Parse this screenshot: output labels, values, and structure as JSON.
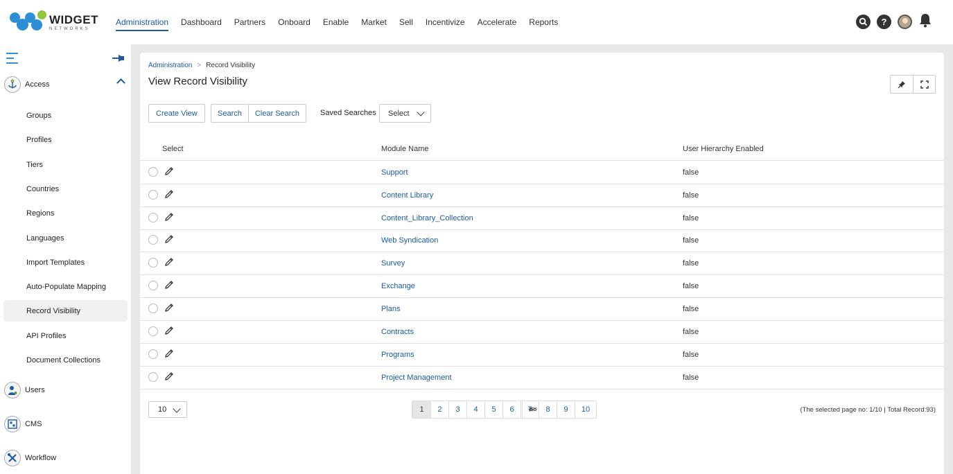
{
  "brand": {
    "title": "WIDGET",
    "subtitle": "NETWORKS"
  },
  "nav": {
    "items": [
      "Administration",
      "Dashboard",
      "Partners",
      "Onboard",
      "Enable",
      "Market",
      "Sell",
      "Incentivize",
      "Accelerate",
      "Reports"
    ],
    "active": "Administration"
  },
  "top_icons": [
    "search-icon",
    "help-icon",
    "user-avatar",
    "bell-icon"
  ],
  "sidebar": {
    "sections": [
      {
        "label": "Access",
        "icon": "anchor-icon",
        "expanded": true
      },
      {
        "label": "Users",
        "icon": "user-icon"
      },
      {
        "label": "CMS",
        "icon": "cms-icon"
      },
      {
        "label": "Workflow",
        "icon": "tools-icon"
      }
    ],
    "items": [
      "Groups",
      "Profiles",
      "Tiers",
      "Countries",
      "Regions",
      "Languages",
      "Import Templates",
      "Auto-Populate Mapping",
      "Record Visibility",
      "API Profiles",
      "Document Collections"
    ],
    "active_item": "Record Visibility"
  },
  "breadcrumb": {
    "parent": "Administration",
    "current": "Record Visibility"
  },
  "page": {
    "title": "View Record Visibility"
  },
  "toolbar": {
    "create_view": "Create View",
    "search": "Search",
    "clear_search": "Clear Search",
    "saved_searches_label": "Saved Searches",
    "saved_searches_value": "Select"
  },
  "table": {
    "headers": [
      "Select",
      "Module Name",
      "User Hierarchy Enabled"
    ],
    "rows": [
      {
        "module": "Support",
        "hierarchy": "false"
      },
      {
        "module": "Content Library",
        "hierarchy": "false"
      },
      {
        "module": "Content_Library_Collection",
        "hierarchy": "false"
      },
      {
        "module": "Web Syndication",
        "hierarchy": "false"
      },
      {
        "module": "Survey",
        "hierarchy": "false"
      },
      {
        "module": "Exchange",
        "hierarchy": "false"
      },
      {
        "module": "Plans",
        "hierarchy": "false"
      },
      {
        "module": "Contracts",
        "hierarchy": "false"
      },
      {
        "module": "Programs",
        "hierarchy": "false"
      },
      {
        "module": "Project Management",
        "hierarchy": "false"
      }
    ]
  },
  "pagination": {
    "page_size": "10",
    "first": "<<",
    "prev": "<",
    "pages": [
      "1",
      "2",
      "3",
      "4",
      "5",
      "6",
      "7",
      "8",
      "9",
      "10"
    ],
    "next": ">",
    "last": ">>",
    "current": "1",
    "info": "(The selected page no: 1/10 | Total Record:93)"
  },
  "colors": {
    "accent": "#1a5aa6",
    "logo_blue": "#2d8fd5",
    "logo_green": "#8dc63f"
  }
}
